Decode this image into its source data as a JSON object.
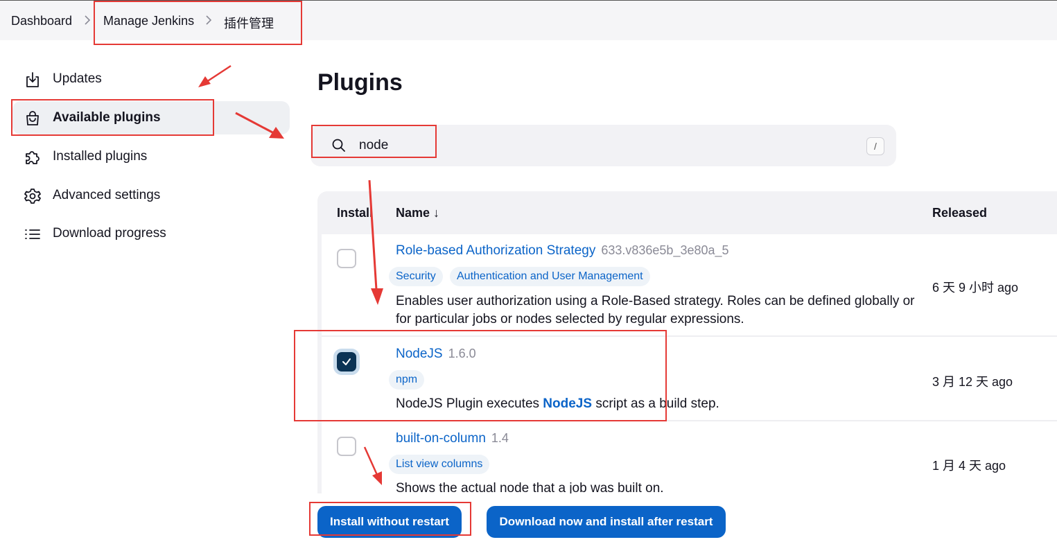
{
  "breadcrumb": {
    "items": [
      "Dashboard",
      "Manage Jenkins",
      "插件管理"
    ],
    "separator": ">"
  },
  "sidebar": {
    "items": [
      {
        "label": "Updates",
        "icon": "download-icon"
      },
      {
        "label": "Available plugins",
        "icon": "shopping-bag-icon",
        "active": true
      },
      {
        "label": "Installed plugins",
        "icon": "puzzle-icon"
      },
      {
        "label": "Advanced settings",
        "icon": "gear-icon"
      },
      {
        "label": "Download progress",
        "icon": "list-icon"
      }
    ]
  },
  "main": {
    "title": "Plugins",
    "search": {
      "value": "node",
      "shortcut": "/"
    },
    "table": {
      "headers": {
        "install": "Install",
        "name": "Name ↓",
        "released": "Released"
      },
      "rows": [
        {
          "name": "Role-based Authorization Strategy",
          "version": "633.v836e5b_3e80a_5",
          "tags": [
            "Security",
            "Authentication and User Management"
          ],
          "description": "Enables user authorization using a Role-Based strategy. Roles can be defined globally or for particular jobs or nodes selected by regular expressions.",
          "released": "6 天 9 小时 ago",
          "checked": false
        },
        {
          "name": "NodeJS",
          "version": "1.6.0",
          "tags": [
            "npm"
          ],
          "description_pre": "NodeJS Plugin executes ",
          "description_link": "NodeJS",
          "description_post": " script as a build step.",
          "released": "3 月 12 天 ago",
          "checked": true
        },
        {
          "name": "built-on-column",
          "version": "1.4",
          "tags": [
            "List view columns"
          ],
          "description": "Shows the actual node that a job was built on.",
          "released": "1 月 4 天 ago",
          "checked": false
        }
      ]
    }
  },
  "footer": {
    "install_label": "Install without restart",
    "download_label": "Download now and install after restart"
  },
  "colors": {
    "accent": "#0b64c8",
    "checked": "#0b3355",
    "annotation": "#e53935"
  }
}
